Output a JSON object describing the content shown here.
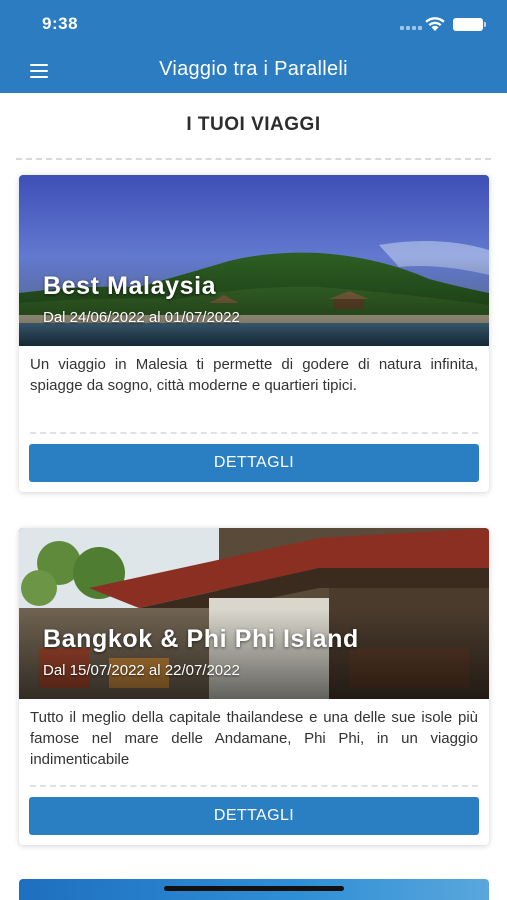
{
  "status_bar": {
    "time": "9:38"
  },
  "header": {
    "title": "Viaggio tra i Paralleli",
    "menu_icon": "hamburger-menu-icon"
  },
  "section": {
    "title": "I TUOI VIAGGI"
  },
  "trips": [
    {
      "title": "Best Malaysia",
      "dates": "Dal 24/06/2022 al 01/07/2022",
      "description": "Un viaggio in Malesia ti permette di godere di natura infinita, spiagge da sogno, città moderne e quartieri tipici.",
      "button": "DETTAGLI"
    },
    {
      "title": "Bangkok & Phi Phi Island",
      "dates": "Dal 15/07/2022 al 22/07/2022",
      "description": "Tutto il meglio della capitale thailandese e una delle sue isole più famose nel mare delle Andamane, Phi Phi, in un viaggio indimenticabile",
      "button": "DETTAGLI"
    }
  ],
  "colors": {
    "primary": "#2b7cc1",
    "button": "#2a7fc3",
    "text": "#333333"
  }
}
